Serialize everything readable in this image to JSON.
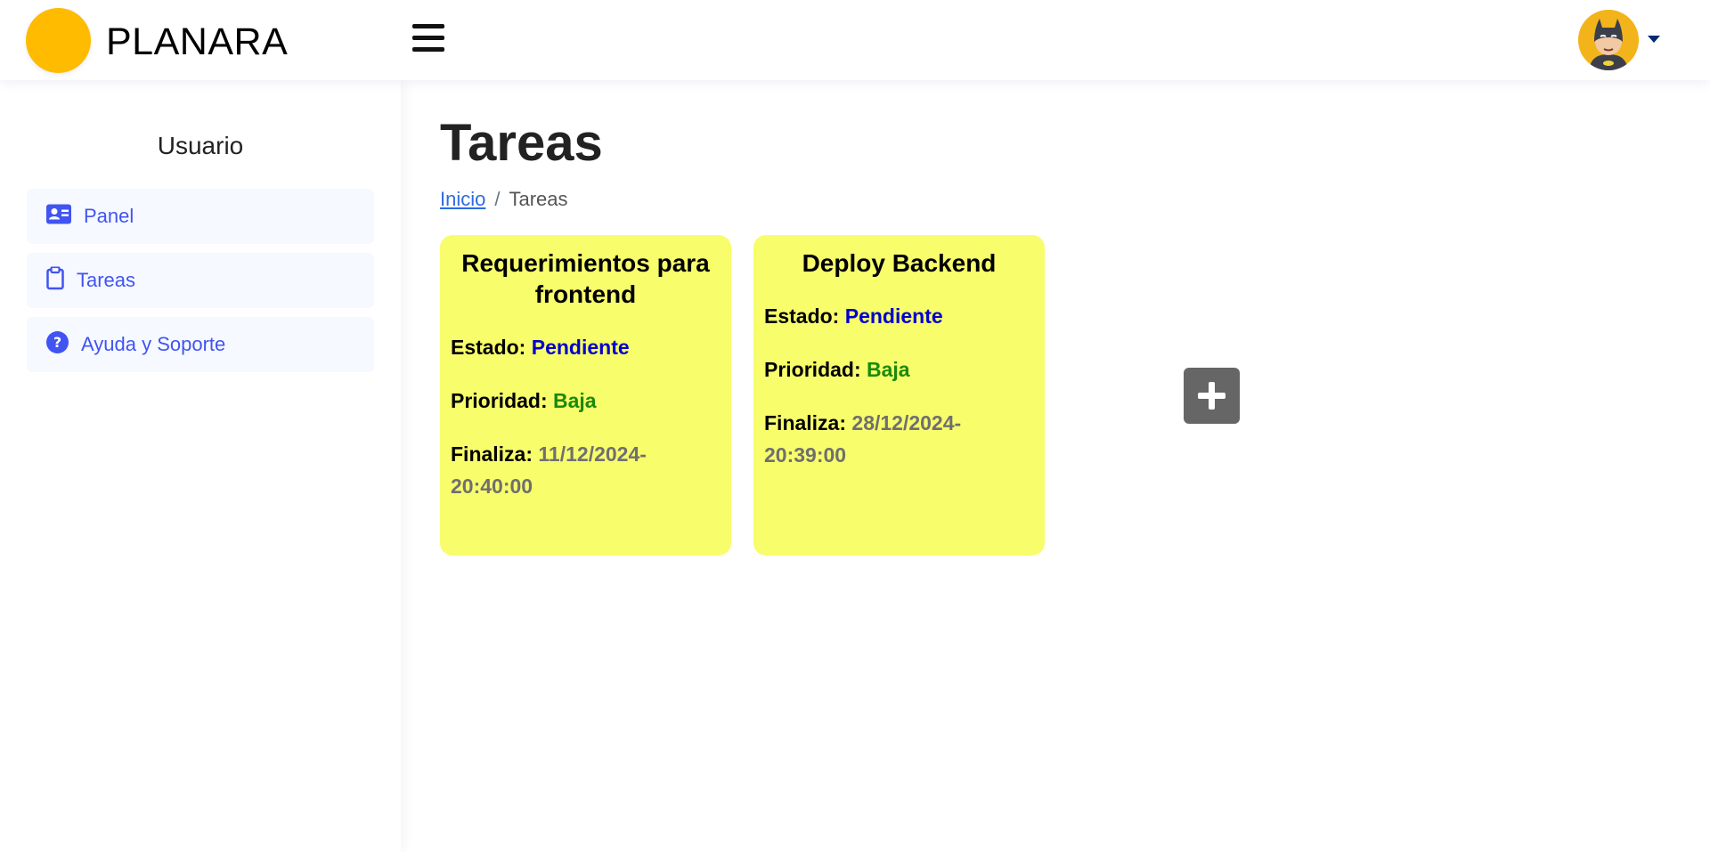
{
  "header": {
    "brand": "PLANARA",
    "brand_color": "#ffbb00",
    "menu_icon": "hamburger-icon",
    "avatar_icon": "batman-avatar",
    "caret_icon": "caret-down-icon"
  },
  "sidebar": {
    "title": "Usuario",
    "accent_color": "#4154f1",
    "items": [
      {
        "label": "Panel",
        "icon": "id-card-icon"
      },
      {
        "label": "Tareas",
        "icon": "clipboard-icon"
      },
      {
        "label": "Ayuda y Soporte",
        "icon": "question-circle-icon"
      }
    ]
  },
  "main": {
    "title": "Tareas",
    "breadcrumb": {
      "home": "Inicio",
      "separator": "/",
      "current": "Tareas"
    },
    "tasks": [
      {
        "title": "Requerimientos para frontend",
        "state_label": "Estado:",
        "state": "Pendiente",
        "priority_label": "Prioridad:",
        "priority": "Baja",
        "end_label": "Finaliza:",
        "end": "11/12/2024-20:40:00"
      },
      {
        "title": "Deploy Backend",
        "state_label": "Estado:",
        "state": "Pendiente",
        "priority_label": "Prioridad:",
        "priority": "Baja",
        "end_label": "Finaliza:",
        "end": "28/12/2024-20:39:00"
      }
    ],
    "add_icon": "plus-icon",
    "card_color": "#f8fd6c"
  }
}
